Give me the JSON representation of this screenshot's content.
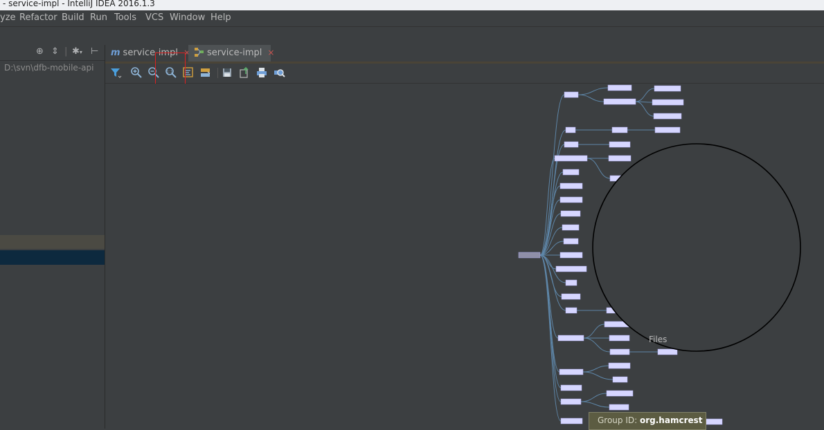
{
  "window": {
    "title": "- service-impl - IntelliJ IDEA 2016.1.3"
  },
  "menu": {
    "items": [
      {
        "label": "yze"
      },
      {
        "label": "Refactor"
      },
      {
        "label": "Build"
      },
      {
        "label": "Run"
      },
      {
        "label": "Tools"
      },
      {
        "label": "VCS"
      },
      {
        "label": "Window"
      },
      {
        "label": "Help"
      }
    ]
  },
  "project_panel": {
    "path": "D:\\svn\\dfb-mobile-api",
    "icons": [
      "target-icon",
      "collapse-icon",
      "gear-icon",
      "hide-icon"
    ]
  },
  "tabs": [
    {
      "label": "service-impl",
      "icon": "maven-m-icon",
      "active": false
    },
    {
      "label": "service-impl",
      "icon": "dependency-diagram-icon",
      "active": true
    }
  ],
  "diagram_toolbar": {
    "icons": [
      "filter-icon",
      "zoom-in-icon",
      "zoom-out-icon",
      "actual-size-icon",
      "fit-content-icon",
      "apply-layout-icon",
      "save-icon",
      "export-icon",
      "print-icon",
      "print-preview-icon"
    ]
  },
  "diagram": {
    "partial_label": "Files",
    "tooltip": {
      "prefix": "Group ID:",
      "value": "org.hamcrest"
    }
  },
  "colors": {
    "node": "#d6d6ff",
    "edge": "#5e86a8",
    "root": "#8f8fa8",
    "highlight_box": "#e02020"
  }
}
